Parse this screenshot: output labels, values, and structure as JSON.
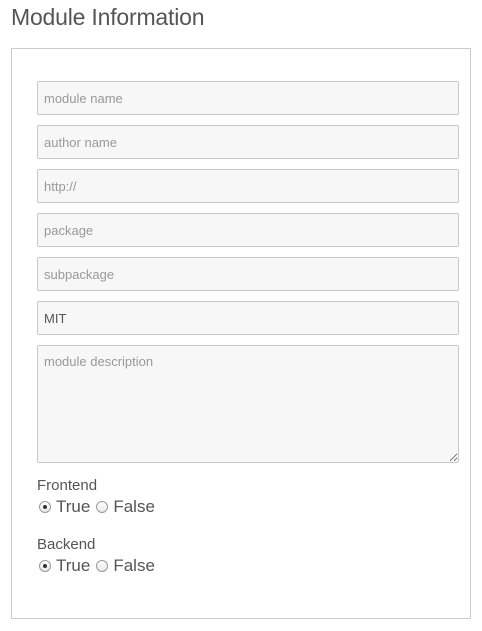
{
  "page": {
    "title": "Module Information"
  },
  "form": {
    "module_name": {
      "value": "",
      "placeholder": "module name"
    },
    "author_name": {
      "value": "",
      "placeholder": "author name"
    },
    "url": {
      "value": "",
      "placeholder": "http://"
    },
    "package": {
      "value": "",
      "placeholder": "package"
    },
    "subpackage": {
      "value": "",
      "placeholder": "subpackage"
    },
    "license": {
      "value": "MIT",
      "placeholder": ""
    },
    "description": {
      "value": "",
      "placeholder": "module description"
    },
    "frontend": {
      "label": "Frontend",
      "options": [
        "True",
        "False"
      ],
      "selected": "True"
    },
    "backend": {
      "label": "Backend",
      "options": [
        "True",
        "False"
      ],
      "selected": "True"
    }
  }
}
